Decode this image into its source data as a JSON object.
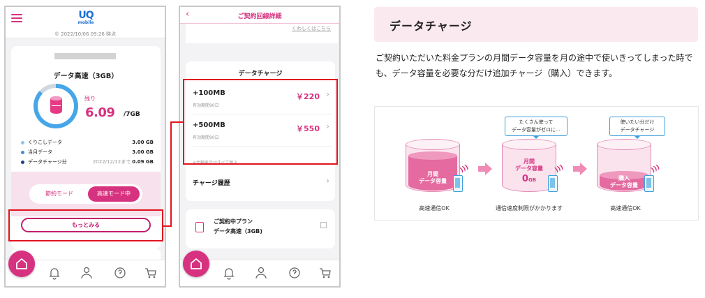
{
  "phone1": {
    "logo_main": "UQ",
    "logo_sub": "mobile",
    "timestamp": "© 2022/10/06 09:26 時点",
    "plan_title": "データ高速（3GB）",
    "remaining_label": "残り",
    "remaining_value": "6.09",
    "remaining_unit": "/7GB",
    "remaining_fraction": 0.87,
    "rows": [
      {
        "name": "くりこしデータ",
        "sub": "",
        "value": "3.00 GB",
        "color": "#8fc8ef"
      },
      {
        "name": "当月データ",
        "sub": "",
        "value": "3.00 GB",
        "color": "#3f8fe0"
      },
      {
        "name": "データチャージ分",
        "sub": "2022/12/12まで",
        "value": "0.09 GB",
        "color": "#1c3f8a"
      }
    ],
    "mode_saving": "節約モード",
    "mode_fast": "高速モード中",
    "more_button": "もっとみる",
    "tabs": [
      "home-icon",
      "bell-icon",
      "person-icon",
      "support-icon",
      "cart-icon"
    ]
  },
  "phone2": {
    "back": "‹",
    "title": "ご契約回線詳細",
    "top_link": "くわしくはこちら",
    "section_title": "データチャージ",
    "options": [
      {
        "amount": "+100MB",
        "validity": "有効期間90日",
        "price": "￥220"
      },
      {
        "amount": "+500MB",
        "validity": "有効期間90日",
        "price": "￥550"
      }
    ],
    "tax_note": "※金額表示はすべて税込",
    "history": "チャージ履歴",
    "plan_line1": "ご契約中プラン",
    "plan_line2": "データ高速（3GB)"
  },
  "right": {
    "heading": "データチャージ",
    "description": "ご契約いただいた料金プランの月間データ容量を月の途中で使いきってしまった時でも、データ容量を必要な分だけ追加チャージ（購入）できます。",
    "diagram": {
      "tank1_text": [
        "月間",
        "データ容量"
      ],
      "tank2_text": [
        "月間",
        "データ容量"
      ],
      "tank2_zero": "0",
      "tank2_zero_unit": "GB",
      "tank3_text": [
        "購入",
        "データ容量"
      ],
      "bubble1": [
        "たくさん使って",
        "データ容量がゼロに…"
      ],
      "bubble2": [
        "使いたい分だけ",
        "データチャージ"
      ],
      "caption1": "高速通信OK",
      "caption2": "通信速度制限がかかります",
      "caption3": "高速通信OK"
    }
  },
  "colors": {
    "accent": "#d6327f",
    "highlight": "#e1141e",
    "blue": "#3fa0dc"
  }
}
